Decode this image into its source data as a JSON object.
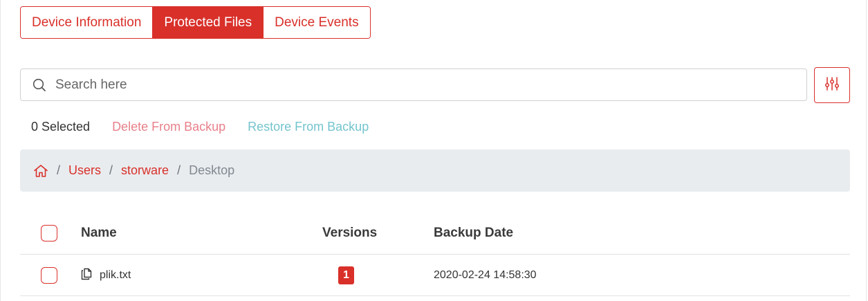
{
  "tabs": [
    {
      "label": "Device Information",
      "active": false
    },
    {
      "label": "Protected Files",
      "active": true
    },
    {
      "label": "Device Events",
      "active": false
    }
  ],
  "search": {
    "placeholder": "Search here",
    "value": ""
  },
  "actions": {
    "selected": "0 Selected",
    "delete": "Delete From Backup",
    "restore": "Restore From Backup"
  },
  "breadcrumb": {
    "items": [
      "Users",
      "storware"
    ],
    "current": "Desktop"
  },
  "table": {
    "columns": [
      "Name",
      "Versions",
      "Backup Date"
    ],
    "rows": [
      {
        "name": "plik.txt",
        "versions": "1",
        "backup_date": "2020-02-24 14:58:30"
      }
    ]
  },
  "colors": {
    "accent": "#d9302a",
    "delete_link": "#e8808a",
    "restore_link": "#74c4cd",
    "breadcrumb_bg": "#e9ecef"
  }
}
